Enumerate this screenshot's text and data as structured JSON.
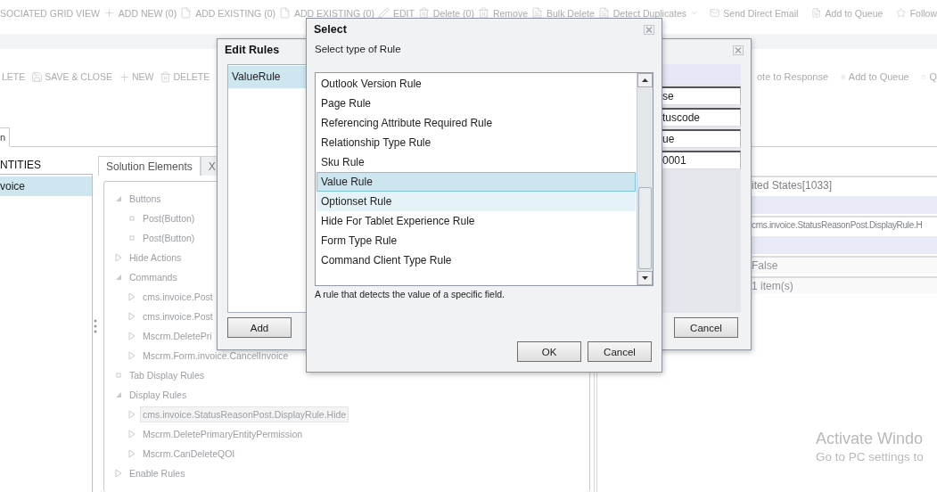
{
  "toolbar": {
    "left": [
      {
        "label": "SOCIATED GRID VIEW"
      },
      {
        "label": "ADD NEW (0)"
      },
      {
        "label": "ADD EXISTING (0)"
      },
      {
        "label": "ADD EXISTING (0)"
      },
      {
        "label": "EDIT"
      },
      {
        "label": "Delete (0)"
      },
      {
        "label": "Remove"
      },
      {
        "label": "Bulk Delete"
      },
      {
        "label": "Detect Duplicates",
        "dropdown": true
      }
    ],
    "right": [
      {
        "label": "Send Direct Email"
      },
      {
        "label": "Add to Queue"
      },
      {
        "label": "Follow"
      }
    ]
  },
  "command_bar": {
    "left": [
      {
        "label": "LETE"
      },
      {
        "label": "SAVE & CLOSE"
      },
      {
        "label": "NEW"
      },
      {
        "label": "DELETE"
      }
    ],
    "right": [
      {
        "label": "ote to Response"
      },
      {
        "label": "Add to Queue"
      },
      {
        "label": "Q"
      }
    ]
  },
  "tabs": [
    {
      "label": "n",
      "selected": true
    }
  ],
  "entities": {
    "heading": "NTITIES",
    "items": [
      {
        "label": "voice",
        "selected": true
      }
    ]
  },
  "solution_panel": {
    "tabs": [
      {
        "label": "Solution Elements",
        "selected": true
      },
      {
        "label": "X",
        "selected": false
      }
    ],
    "tree": [
      {
        "label": "Buttons",
        "kind": "open",
        "selected": false,
        "children": [
          {
            "label": "Post(Button)",
            "kind": "leaf",
            "selected": false
          },
          {
            "label": "Post(Button)",
            "kind": "leaf",
            "selected": false
          }
        ]
      },
      {
        "label": "Hide Actions",
        "kind": "closed",
        "selected": false
      },
      {
        "label": "Commands",
        "kind": "open",
        "selected": false,
        "children": [
          {
            "label": "cms.invoice.Post",
            "kind": "closed",
            "selected": false
          },
          {
            "label": "cms.invoice.Post",
            "kind": "closed",
            "selected": false
          },
          {
            "label": "Mscrm.DeletePri",
            "kind": "closed",
            "selected": false
          },
          {
            "label": "Mscrm.Form.invoice.CancelInvoice",
            "kind": "closed",
            "selected": false
          }
        ]
      },
      {
        "label": "Tab Display Rules",
        "kind": "leaf",
        "selected": false
      },
      {
        "label": "Display Rules",
        "kind": "open",
        "selected": false,
        "children": [
          {
            "label": "cms.invoice.StatusReasonPost.DisplayRule.Hide",
            "kind": "closed",
            "selected": true
          },
          {
            "label": "Mscrm.DeletePrimaryEntityPermission",
            "kind": "closed",
            "selected": false
          },
          {
            "label": "Mscrm.CanDeleteQOI",
            "kind": "closed",
            "selected": false
          }
        ]
      },
      {
        "label": "Enable Rules",
        "kind": "closed",
        "selected": false
      }
    ]
  },
  "properties": {
    "rows": [
      {
        "kind": "field",
        "value": "ited States[1033]"
      },
      {
        "kind": "header"
      },
      {
        "kind": "field",
        "value": "cms.invoice.StatusReasonPost.DisplayRule.H"
      },
      {
        "kind": "header"
      },
      {
        "kind": "readonly",
        "value": "False"
      },
      {
        "kind": "readonly",
        "value": "1 item(s)"
      }
    ]
  },
  "edit_rules_dialog": {
    "title": "Edit Rules",
    "rules": [
      {
        "label": "ValueRule",
        "selected": true
      }
    ],
    "fields": [
      "se",
      "tuscode",
      "ue",
      "0001"
    ],
    "buttons": [
      "Add",
      "Cancel"
    ]
  },
  "select_dialog": {
    "title": "Select",
    "prompt": "Select type of Rule",
    "options": [
      {
        "label": "Outlook Version Rule",
        "selected": false,
        "highlighted": false
      },
      {
        "label": "Page Rule",
        "selected": false,
        "highlighted": false
      },
      {
        "label": "Referencing Attribute Required Rule",
        "selected": false,
        "highlighted": false
      },
      {
        "label": "Relationship Type Rule",
        "selected": false,
        "highlighted": false
      },
      {
        "label": "Sku Rule",
        "selected": false,
        "highlighted": false
      },
      {
        "label": "Value Rule",
        "selected": true,
        "highlighted": false
      },
      {
        "label": "Optionset Rule",
        "selected": false,
        "highlighted": true
      },
      {
        "label": "Hide For Tablet Experience  Rule",
        "selected": false,
        "highlighted": false
      },
      {
        "label": "Form Type Rule",
        "selected": false,
        "highlighted": false
      },
      {
        "label": "Command Client Type Rule",
        "selected": false,
        "highlighted": false
      }
    ],
    "description": "A rule that detects the value of a specific field.",
    "buttons": [
      "OK",
      "Cancel"
    ]
  },
  "activation_notice": {
    "title": "Activate Windo",
    "subtitle": "Go to PC settings to"
  }
}
